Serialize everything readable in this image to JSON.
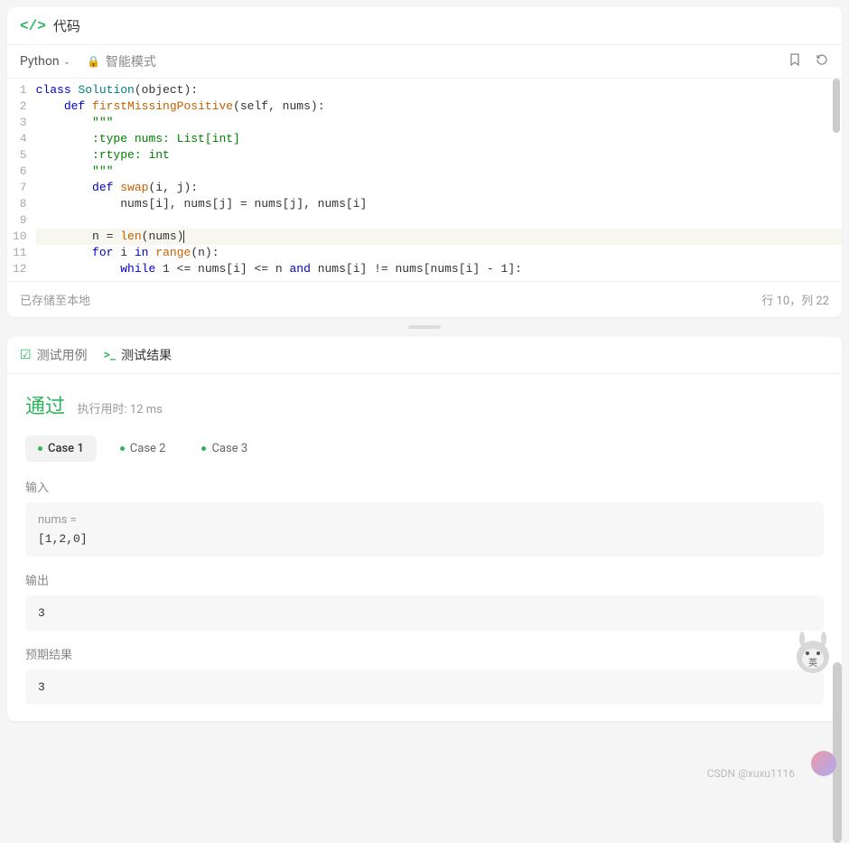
{
  "header": {
    "title": "代码"
  },
  "toolbar": {
    "language": "Python",
    "mode": "智能模式",
    "bookmark_tip": "书签",
    "reset_tip": "重置"
  },
  "editor": {
    "lines": [
      "1",
      "2",
      "3",
      "4",
      "5",
      "6",
      "7",
      "8",
      "9",
      "10",
      "11",
      "12"
    ],
    "cursor_line": 10,
    "code": {
      "l1": {
        "kw1": "class",
        "cls": "Solution",
        "rest": "(object):"
      },
      "l2": {
        "kw1": "def",
        "fn": "firstMissingPositive",
        "args": "(self, nums):"
      },
      "l3": "\"\"\"",
      "l4": ":type nums: List[int]",
      "l5": ":rtype: int",
      "l6": "\"\"\"",
      "l7": {
        "kw1": "def",
        "fn": "swap",
        "args": "(i, j):"
      },
      "l8": "nums[i], nums[j] = nums[j], nums[i]",
      "l10_a": "n = ",
      "l10_fn": "len",
      "l10_b": "(nums)",
      "l11": {
        "kw1": "for",
        "id": "i",
        "kw2": "in",
        "fn": "range",
        "rest": "(n):"
      },
      "l12": {
        "kw1": "while",
        "body": " 1 <= nums[i] <= n ",
        "kw2": "and",
        "body2": " nums[i] != nums[nums[i] - 1]:"
      }
    }
  },
  "footer": {
    "saved": "已存储至本地",
    "position": "行 10，列 22"
  },
  "tabs": {
    "testcase": "测试用例",
    "result": "测试结果"
  },
  "result": {
    "pass": "通过",
    "runtime": "执行用时: 12 ms",
    "cases": [
      "Case 1",
      "Case 2",
      "Case 3"
    ],
    "input_label": "输入",
    "input_var": "nums =",
    "input_value": "[1,2,0]",
    "output_label": "输出",
    "output_value": "3",
    "expected_label": "预期结果",
    "expected_value": "3"
  },
  "watermark": "CSDN @xuxu1116"
}
